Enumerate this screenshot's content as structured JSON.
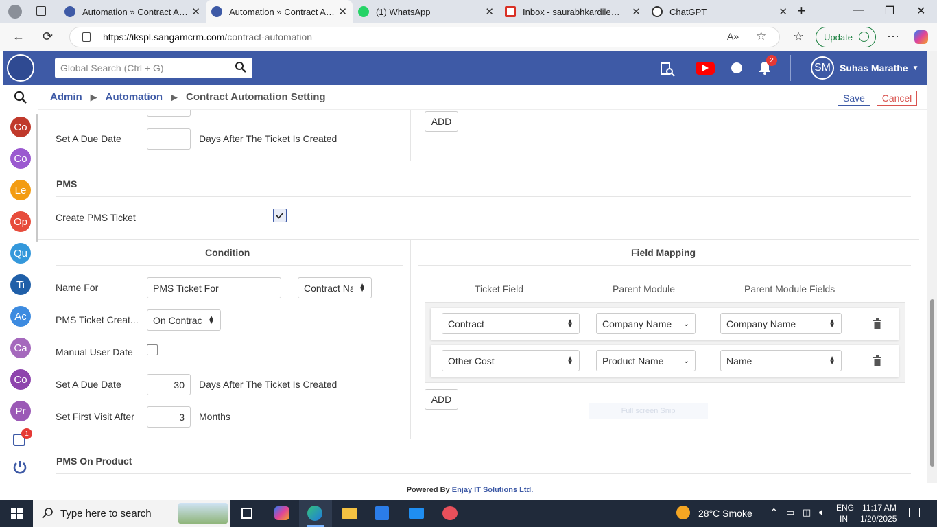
{
  "browser": {
    "tabs": [
      {
        "title": "Automation » Contract Automation Setting",
        "active": false
      },
      {
        "title": "Automation » Contract Automation Setting",
        "active": true
      },
      {
        "title": "(1) WhatsApp",
        "active": false
      },
      {
        "title": "Inbox - saurabhkardile@reliance",
        "active": false
      },
      {
        "title": "ChatGPT",
        "active": false
      }
    ],
    "url_host": "https://ikspl.sangamcrm.com",
    "url_path": "/contract-automation",
    "update_label": "Update"
  },
  "header": {
    "search_placeholder": "Global Search (Ctrl + G)",
    "notification_count": "2",
    "user_initials": "SM",
    "user_name": "Suhas Marathe"
  },
  "sidebar": {
    "items": [
      {
        "label": "Co",
        "color": "#c0392b"
      },
      {
        "label": "Co",
        "color": "#9b59d0"
      },
      {
        "label": "Le",
        "color": "#f39c12"
      },
      {
        "label": "Op",
        "color": "#e74c3c"
      },
      {
        "label": "Qu",
        "color": "#3498db"
      },
      {
        "label": "Ti",
        "color": "#1f5fa8"
      },
      {
        "label": "Ac",
        "color": "#3d8be0"
      },
      {
        "label": "Ca",
        "color": "#a569bd"
      },
      {
        "label": "Co",
        "color": "#8e44ad"
      },
      {
        "label": "Pr",
        "color": "#9b59b6"
      }
    ],
    "inbox_badge": "1"
  },
  "breadcrumb": {
    "items": [
      "Admin",
      "Automation",
      "Contract Automation Setting"
    ],
    "save_label": "Save",
    "cancel_label": "Cancel"
  },
  "top": {
    "due_label": "Set A Due Date",
    "due_value": "",
    "due_suffix": "Days After The Ticket Is Created",
    "add_label": "ADD"
  },
  "pms": {
    "section_title": "PMS",
    "create_label": "Create PMS Ticket",
    "create_checked": true,
    "condition_title": "Condition",
    "name_for_label": "Name For",
    "name_for_value": "PMS Ticket For",
    "name_for_field": "Contract Na",
    "created_label": "PMS Ticket Creat...",
    "created_value": "On Contrac",
    "manual_label": "Manual User Date",
    "manual_checked": false,
    "due_label": "Set A Due Date",
    "due_value": "30",
    "due_suffix": "Days After The Ticket Is Created",
    "visit_label": "Set First Visit After",
    "visit_value": "3",
    "visit_suffix": "Months"
  },
  "mapping": {
    "title": "Field Mapping",
    "col_ticket": "Ticket Field",
    "col_parent": "Parent Module",
    "col_parent_fields": "Parent Module Fields",
    "rows": [
      {
        "ticket": "Contract",
        "parent": "Company Name",
        "field": "Company Name"
      },
      {
        "ticket": "Other Cost",
        "parent": "Product Name",
        "field": "Name"
      }
    ],
    "add_label": "ADD",
    "tooltip": "Full screen Snip"
  },
  "pms_product": {
    "title": "PMS On Product"
  },
  "footer": {
    "prefix": "Powered By",
    "company": "Enjay IT Solutions Ltd."
  },
  "taskbar": {
    "search_placeholder": "Type here to search",
    "weather": "28°C  Smoke",
    "lang1": "ENG",
    "lang2": "IN",
    "time": "11:17 AM",
    "date": "1/20/2025"
  }
}
